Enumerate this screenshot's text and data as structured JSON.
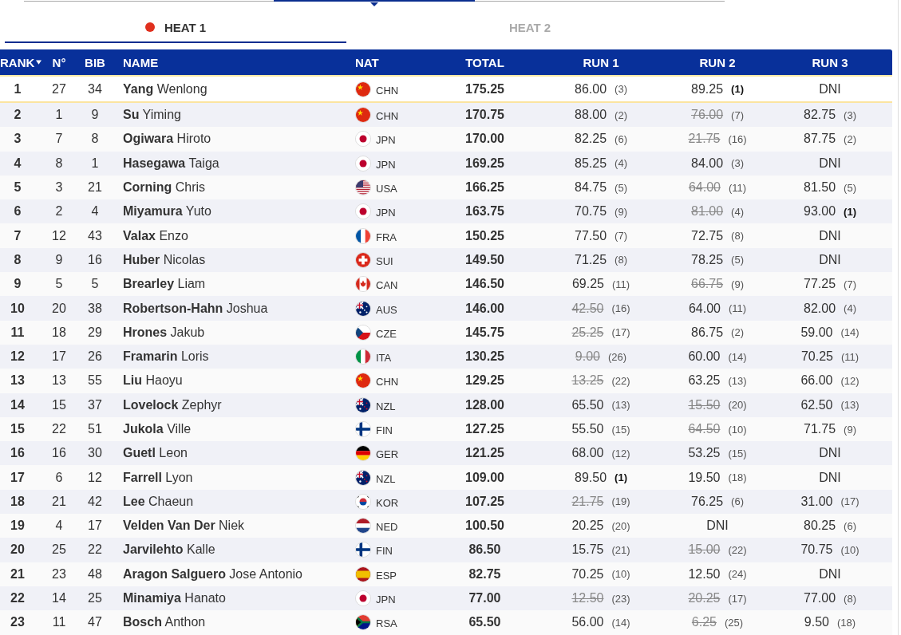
{
  "tabs": [
    {
      "label": "HEAT 1",
      "selected": true,
      "live": true
    },
    {
      "label": "HEAT 2",
      "selected": false,
      "live": false
    }
  ],
  "table": {
    "columns": [
      {
        "label": "RANK",
        "sorted": true
      },
      {
        "label": "N°"
      },
      {
        "label": "BIB"
      },
      {
        "label": "NAME"
      },
      {
        "label": "NAT"
      },
      {
        "label": "TOTAL"
      },
      {
        "label": "RUN 1"
      },
      {
        "label": "RUN 2"
      },
      {
        "label": "RUN 3"
      }
    ],
    "rows": [
      {
        "rank": "1",
        "no": "27",
        "bib": "34",
        "name": "**Yang** Wenlong",
        "kind": "china",
        "nat": "CHN",
        "total": "175.25",
        "highlighted": true,
        "runs": [
          {
            "score": "86.00",
            "place": "(3)",
            "best": false,
            "discarded": false
          },
          {
            "score": "89.25",
            "place": "(1)",
            "best": true,
            "discarded": false
          },
          {
            "score": "DNI",
            "discarded": false
          }
        ]
      },
      {
        "rank": "2",
        "no": "1",
        "bib": "9",
        "name": "**Su** Yiming",
        "kind": "china",
        "nat": "CHN",
        "total": "170.75",
        "highlighted": false,
        "runs": [
          {
            "score": "88.00",
            "place": "(2)",
            "best": false,
            "discarded": false
          },
          {
            "score": "76.00",
            "place": "(7)",
            "best": false,
            "discarded": true
          },
          {
            "score": "82.75",
            "place": "(3)",
            "best": false,
            "discarded": false
          }
        ]
      },
      {
        "rank": "3",
        "no": "7",
        "bib": "8",
        "name": "**Ogiwara** Hiroto",
        "kind": "japan",
        "nat": "JPN",
        "total": "170.00",
        "highlighted": false,
        "runs": [
          {
            "score": "82.25",
            "place": "(6)",
            "best": false,
            "discarded": false
          },
          {
            "score": "21.75",
            "place": "(16)",
            "best": false,
            "discarded": true
          },
          {
            "score": "87.75",
            "place": "(2)",
            "best": false,
            "discarded": false
          }
        ]
      },
      {
        "rank": "4",
        "no": "8",
        "bib": "1",
        "name": "**Hasegawa** Taiga",
        "kind": "japan",
        "nat": "JPN",
        "total": "169.25",
        "highlighted": false,
        "runs": [
          {
            "score": "85.25",
            "place": "(4)",
            "best": false,
            "discarded": false
          },
          {
            "score": "84.00",
            "place": "(3)",
            "best": false,
            "discarded": false
          },
          {
            "score": "DNI",
            "discarded": false
          }
        ]
      },
      {
        "rank": "5",
        "no": "3",
        "bib": "21",
        "name": "**Corning** Chris",
        "kind": "usa",
        "nat": "USA",
        "total": "166.25",
        "highlighted": false,
        "runs": [
          {
            "score": "84.75",
            "place": "(5)",
            "best": false,
            "discarded": false
          },
          {
            "score": "64.00",
            "place": "(11)",
            "best": false,
            "discarded": true
          },
          {
            "score": "81.50",
            "place": "(5)",
            "best": false,
            "discarded": false
          }
        ]
      },
      {
        "rank": "6",
        "no": "2",
        "bib": "4",
        "name": "**Miyamura** Yuto",
        "kind": "japan",
        "nat": "JPN",
        "total": "163.75",
        "highlighted": false,
        "runs": [
          {
            "score": "70.75",
            "place": "(9)",
            "best": false,
            "discarded": false
          },
          {
            "score": "81.00",
            "place": "(4)",
            "best": false,
            "discarded": true
          },
          {
            "score": "93.00",
            "place": "(1)",
            "best": true,
            "discarded": false
          }
        ]
      },
      {
        "rank": "7",
        "no": "12",
        "bib": "43",
        "name": "**Valax** Enzo",
        "kind": "france",
        "nat": "FRA",
        "total": "150.25",
        "highlighted": false,
        "runs": [
          {
            "score": "77.50",
            "place": "(7)",
            "best": false,
            "discarded": false
          },
          {
            "score": "72.75",
            "place": "(8)",
            "best": false,
            "discarded": false
          },
          {
            "score": "DNI",
            "discarded": false
          }
        ]
      },
      {
        "rank": "8",
        "no": "9",
        "bib": "16",
        "name": "**Huber** Nicolas",
        "kind": "switzerland",
        "nat": "SUI",
        "total": "149.50",
        "highlighted": false,
        "runs": [
          {
            "score": "71.25",
            "place": "(8)",
            "best": false,
            "discarded": false
          },
          {
            "score": "78.25",
            "place": "(5)",
            "best": false,
            "discarded": false
          },
          {
            "score": "DNI",
            "discarded": false
          }
        ]
      },
      {
        "rank": "9",
        "no": "5",
        "bib": "5",
        "name": "**Brearley** Liam",
        "kind": "canada",
        "nat": "CAN",
        "total": "146.50",
        "highlighted": false,
        "runs": [
          {
            "score": "69.25",
            "place": "(11)",
            "best": false,
            "discarded": false
          },
          {
            "score": "66.75",
            "place": "(9)",
            "best": false,
            "discarded": true
          },
          {
            "score": "77.25",
            "place": "(7)",
            "best": false,
            "discarded": false
          }
        ]
      },
      {
        "rank": "10",
        "no": "20",
        "bib": "38",
        "name": "**Robertson-Hahn** Joshua",
        "kind": "australia",
        "nat": "AUS",
        "total": "146.00",
        "highlighted": false,
        "runs": [
          {
            "score": "42.50",
            "place": "(16)",
            "best": false,
            "discarded": true
          },
          {
            "score": "64.00",
            "place": "(11)",
            "best": false,
            "discarded": false
          },
          {
            "score": "82.00",
            "place": "(4)",
            "best": false,
            "discarded": false
          }
        ]
      },
      {
        "rank": "11",
        "no": "18",
        "bib": "29",
        "name": "**Hrones** Jakub",
        "kind": "czech",
        "nat": "CZE",
        "total": "145.75",
        "highlighted": false,
        "runs": [
          {
            "score": "25.25",
            "place": "(17)",
            "best": false,
            "discarded": true
          },
          {
            "score": "86.75",
            "place": "(2)",
            "best": false,
            "discarded": false
          },
          {
            "score": "59.00",
            "place": "(14)",
            "best": false,
            "discarded": false
          }
        ]
      },
      {
        "rank": "12",
        "no": "17",
        "bib": "26",
        "name": "**Framarin** Loris",
        "kind": "italy",
        "nat": "ITA",
        "total": "130.25",
        "highlighted": false,
        "runs": [
          {
            "score": "9.00",
            "place": "(26)",
            "best": false,
            "discarded": true
          },
          {
            "score": "60.00",
            "place": "(14)",
            "best": false,
            "discarded": false
          },
          {
            "score": "70.25",
            "place": "(11)",
            "best": false,
            "discarded": false
          }
        ]
      },
      {
        "rank": "13",
        "no": "13",
        "bib": "55",
        "name": "**Liu** Haoyu",
        "kind": "china",
        "nat": "CHN",
        "total": "129.25",
        "highlighted": false,
        "runs": [
          {
            "score": "13.25",
            "place": "(22)",
            "best": false,
            "discarded": true
          },
          {
            "score": "63.25",
            "place": "(13)",
            "best": false,
            "discarded": false
          },
          {
            "score": "66.00",
            "place": "(12)",
            "best": false,
            "discarded": false
          }
        ]
      },
      {
        "rank": "14",
        "no": "15",
        "bib": "37",
        "name": "**Lovelock** Zephyr",
        "kind": "newzealand",
        "nat": "NZL",
        "total": "128.00",
        "highlighted": false,
        "runs": [
          {
            "score": "65.50",
            "place": "(13)",
            "best": false,
            "discarded": false
          },
          {
            "score": "15.50",
            "place": "(20)",
            "best": false,
            "discarded": true
          },
          {
            "score": "62.50",
            "place": "(13)",
            "best": false,
            "discarded": false
          }
        ]
      },
      {
        "rank": "15",
        "no": "22",
        "bib": "51",
        "name": "**Jukola** Ville",
        "kind": "finland",
        "nat": "FIN",
        "total": "127.25",
        "highlighted": false,
        "runs": [
          {
            "score": "55.50",
            "place": "(15)",
            "best": false,
            "discarded": false
          },
          {
            "score": "64.50",
            "place": "(10)",
            "best": false,
            "discarded": true
          },
          {
            "score": "71.75",
            "place": "(9)",
            "best": false,
            "discarded": false
          }
        ]
      },
      {
        "rank": "16",
        "no": "16",
        "bib": "30",
        "name": "**Guetl** Leon",
        "kind": "germany",
        "nat": "GER",
        "total": "121.25",
        "highlighted": false,
        "runs": [
          {
            "score": "68.00",
            "place": "(12)",
            "best": false,
            "discarded": false
          },
          {
            "score": "53.25",
            "place": "(15)",
            "best": false,
            "discarded": false
          },
          {
            "score": "DNI",
            "discarded": false
          }
        ]
      },
      {
        "rank": "17",
        "no": "6",
        "bib": "12",
        "name": "**Farrell** Lyon",
        "kind": "newzealand",
        "nat": "NZL",
        "total": "109.00",
        "highlighted": false,
        "runs": [
          {
            "score": "89.50",
            "place": "(1)",
            "best": true,
            "discarded": false
          },
          {
            "score": "19.50",
            "place": "(18)",
            "best": false,
            "discarded": false
          },
          {
            "score": "DNI",
            "discarded": false
          }
        ]
      },
      {
        "rank": "18",
        "no": "21",
        "bib": "42",
        "name": "**Lee** Chaeun",
        "kind": "korea",
        "nat": "KOR",
        "total": "107.25",
        "highlighted": false,
        "runs": [
          {
            "score": "21.75",
            "place": "(19)",
            "best": false,
            "discarded": true
          },
          {
            "score": "76.25",
            "place": "(6)",
            "best": false,
            "discarded": false
          },
          {
            "score": "31.00",
            "place": "(17)",
            "best": false,
            "discarded": false
          }
        ]
      },
      {
        "rank": "19",
        "no": "4",
        "bib": "17",
        "name": "**Velden Van Der** Niek",
        "kind": "netherlands",
        "nat": "NED",
        "total": "100.50",
        "highlighted": false,
        "runs": [
          {
            "score": "20.25",
            "place": "(20)",
            "best": false,
            "discarded": false
          },
          {
            "score": "DNI",
            "discarded": false
          },
          {
            "score": "80.25",
            "place": "(6)",
            "best": false,
            "discarded": false
          }
        ]
      },
      {
        "rank": "20",
        "no": "25",
        "bib": "22",
        "name": "**Jarvilehto** Kalle",
        "kind": "finland",
        "nat": "FIN",
        "total": "86.50",
        "highlighted": false,
        "runs": [
          {
            "score": "15.75",
            "place": "(21)",
            "best": false,
            "discarded": false
          },
          {
            "score": "15.00",
            "place": "(22)",
            "best": false,
            "discarded": true
          },
          {
            "score": "70.75",
            "place": "(10)",
            "best": false,
            "discarded": false
          }
        ]
      },
      {
        "rank": "21",
        "no": "23",
        "bib": "48",
        "name": "**Aragon Salguero** Jose Antonio",
        "kind": "spain",
        "nat": "ESP",
        "total": "82.75",
        "highlighted": false,
        "runs": [
          {
            "score": "70.25",
            "place": "(10)",
            "best": false,
            "discarded": false
          },
          {
            "score": "12.50",
            "place": "(24)",
            "best": false,
            "discarded": false
          },
          {
            "score": "DNI",
            "discarded": false
          }
        ]
      },
      {
        "rank": "22",
        "no": "14",
        "bib": "25",
        "name": "**Minamiya** Hanato",
        "kind": "japan",
        "nat": "JPN",
        "total": "77.00",
        "highlighted": false,
        "runs": [
          {
            "score": "12.50",
            "place": "(23)",
            "best": false,
            "discarded": true
          },
          {
            "score": "20.25",
            "place": "(17)",
            "best": false,
            "discarded": true
          },
          {
            "score": "77.00",
            "place": "(8)",
            "best": false,
            "discarded": false
          }
        ]
      },
      {
        "rank": "23",
        "no": "11",
        "bib": "47",
        "name": "**Bosch** Anthon",
        "kind": "southafrica",
        "nat": "RSA",
        "total": "65.50",
        "highlighted": false,
        "runs": [
          {
            "score": "56.00",
            "place": "(14)",
            "best": false,
            "discarded": false
          },
          {
            "score": "6.25",
            "place": "(25)",
            "best": false,
            "discarded": true
          },
          {
            "score": "9.50",
            "place": "(18)",
            "best": false,
            "discarded": false
          }
        ]
      }
    ]
  }
}
